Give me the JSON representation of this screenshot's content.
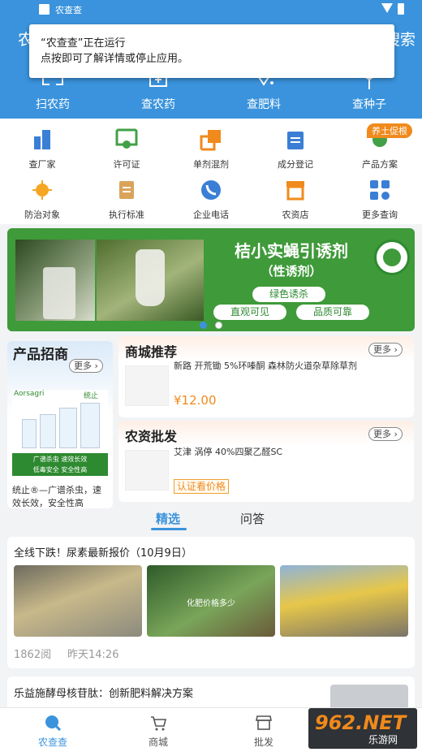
{
  "status_bar": {
    "app_name": "农查查"
  },
  "header": {
    "left_text": "农",
    "right_text": "搜索"
  },
  "notification": {
    "line1": "“农查查”正在运行",
    "line2": "点按即可了解详情或停止应用。"
  },
  "top_nav": [
    {
      "label": "扫农药",
      "icon": "scan-icon"
    },
    {
      "label": "查农药",
      "icon": "pesticide-icon"
    },
    {
      "label": "查肥料",
      "icon": "fertilizer-icon"
    },
    {
      "label": "查种子",
      "icon": "seed-icon"
    }
  ],
  "grid": {
    "row1": [
      {
        "label": "查厂家",
        "icon": "factory-icon",
        "color": "#3a7fd5"
      },
      {
        "label": "许可证",
        "icon": "certificate-icon",
        "color": "#43a047"
      },
      {
        "label": "单剂混剂",
        "icon": "layers-icon",
        "color": "#f08a1c"
      },
      {
        "label": "成分登记",
        "icon": "clipboard-icon",
        "color": "#3a7fd5"
      },
      {
        "label": "产品方案",
        "icon": "lightbulb-icon",
        "color": "#43a047"
      }
    ],
    "row2": [
      {
        "label": "防治对象",
        "icon": "virus-icon",
        "color": "#f5a623"
      },
      {
        "label": "执行标准",
        "icon": "document-icon",
        "color": "#d9a45a"
      },
      {
        "label": "企业电话",
        "icon": "phone-icon",
        "color": "#3a7fd5"
      },
      {
        "label": "农资店",
        "icon": "store-icon",
        "color": "#f08a1c"
      },
      {
        "label": "更多查询",
        "icon": "apps-icon",
        "color": "#3a7fd5"
      }
    ],
    "promo_tag": "养土促根"
  },
  "banner": {
    "title": "桔小实蝇引诱剂",
    "subtitle": "（性诱剂）",
    "pill1": "绿色诱杀",
    "pill2": "直观可见",
    "pill3": "品质可靠"
  },
  "product_recruit": {
    "title": "产品招商",
    "more": "更多",
    "brand": "Aorsagri",
    "brand_cn": "统止",
    "image_caption1": "广谱杀虫 速效长效",
    "image_caption2": "低毒安全 安全性高",
    "desc": "统止®—广谱杀虫，速效长效，安全性高"
  },
  "mall": {
    "title": "商城推荐",
    "more": "更多",
    "product_name": "新路 开荒锄 5%环嗪酮 森林防火道杂草除草剂",
    "price": "¥12.00"
  },
  "wholesale": {
    "title": "农资批发",
    "more": "更多",
    "product_name": "艾津 涡停 40%四聚乙醛SC",
    "price_button": "认证看价格"
  },
  "tabs": {
    "tab1": "精选",
    "tab2": "问答"
  },
  "article1": {
    "title": "全线下跌！尿素最新报价（10月9日）",
    "image_caption": "化肥价格多少",
    "views": "1862阅",
    "time": "昨天14:26"
  },
  "article2": {
    "title": "乐益施酵母核苷肽：创新肥料解决方案"
  },
  "bottom_nav": [
    {
      "label": "农查查",
      "icon": "search-icon",
      "active": true
    },
    {
      "label": "商城",
      "icon": "cart-icon",
      "active": false
    },
    {
      "label": "批发",
      "icon": "shop-icon",
      "active": false
    }
  ],
  "watermark": {
    "brand": "962.NET",
    "sub": "乐游网"
  },
  "colors": {
    "primary": "#3a93dc",
    "accent": "#f08a1c",
    "banner_green": "#3f9a3a"
  }
}
